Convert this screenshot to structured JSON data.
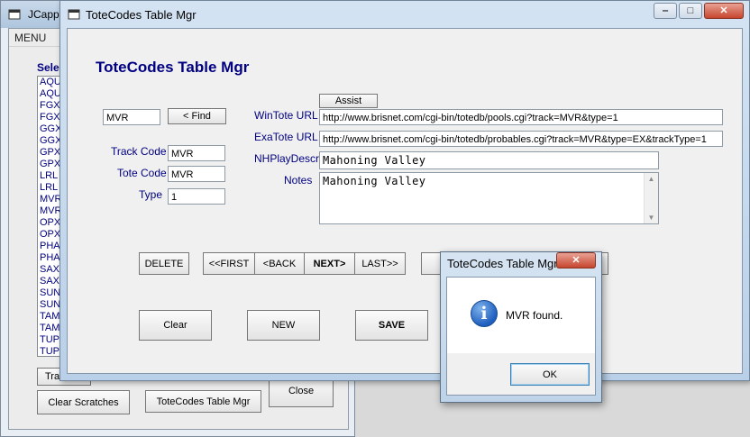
{
  "back_window": {
    "title": "JCappe",
    "menu": "MENU",
    "list_heading": "Sele",
    "list_items": [
      "AQU",
      "AQU",
      "FGX",
      "FGX",
      "GGX",
      "GGX",
      "GPX",
      "GPX",
      "LRL",
      "LRL",
      "MVR",
      "MVR",
      "OPX",
      "OPX",
      "PHA",
      "PHA",
      "SAX",
      "SAX",
      "SUN",
      "SUN",
      "TAM",
      "TAM",
      "TUP",
      "TUP"
    ],
    "track_button": "Trac",
    "clear_scratches_button": "Clear Scratches",
    "totecodes_button": "ToteCodes Table Mgr",
    "close_button": "Close"
  },
  "main_window": {
    "title": "ToteCodes Table Mgr",
    "heading": "ToteCodes Table Mgr",
    "caption_buttons": {
      "minimize": "‒",
      "maximize": "□",
      "close": "✕"
    },
    "search_value": "MVR",
    "find_button": "< Find",
    "track_code_label": "Track Code",
    "track_code_value": "MVR",
    "tote_code_label": "Tote Code",
    "tote_code_value": "MVR",
    "type_label": "Type",
    "type_value": "1",
    "assist_button": "Assist",
    "wintote_label": "WinTote URL",
    "wintote_value": "http://www.brisnet.com/cgi-bin/totedb/pools.cgi?track=MVR&type=1",
    "exatote_label": "ExaTote URL",
    "exatote_value": "http://www.brisnet.com/cgi-bin/totedb/probables.cgi?track=MVR&type=EX&trackType=1",
    "nhplay_label": "NHPlayDescr",
    "nhplay_value": "Mahoning Valley",
    "notes_label": "Notes",
    "notes_value": "Mahoning Valley",
    "delete_button": "DELETE",
    "first_button": "<<FIRST",
    "back_button": "<BACK",
    "next_button": "NEXT>",
    "last_button": "LAST>>",
    "clear_button": "Clear",
    "new_button": "NEW",
    "save_button": "SAVE"
  },
  "dialog": {
    "title": "ToteCodes Table Mgr",
    "close_glyph": "✕",
    "icon_glyph": "i",
    "message": "MVR found.",
    "ok_button": "OK"
  },
  "colors": {
    "label_blue": "#000080",
    "title_gradient_top": "#d4e3f2",
    "close_red": "#c6452e"
  }
}
